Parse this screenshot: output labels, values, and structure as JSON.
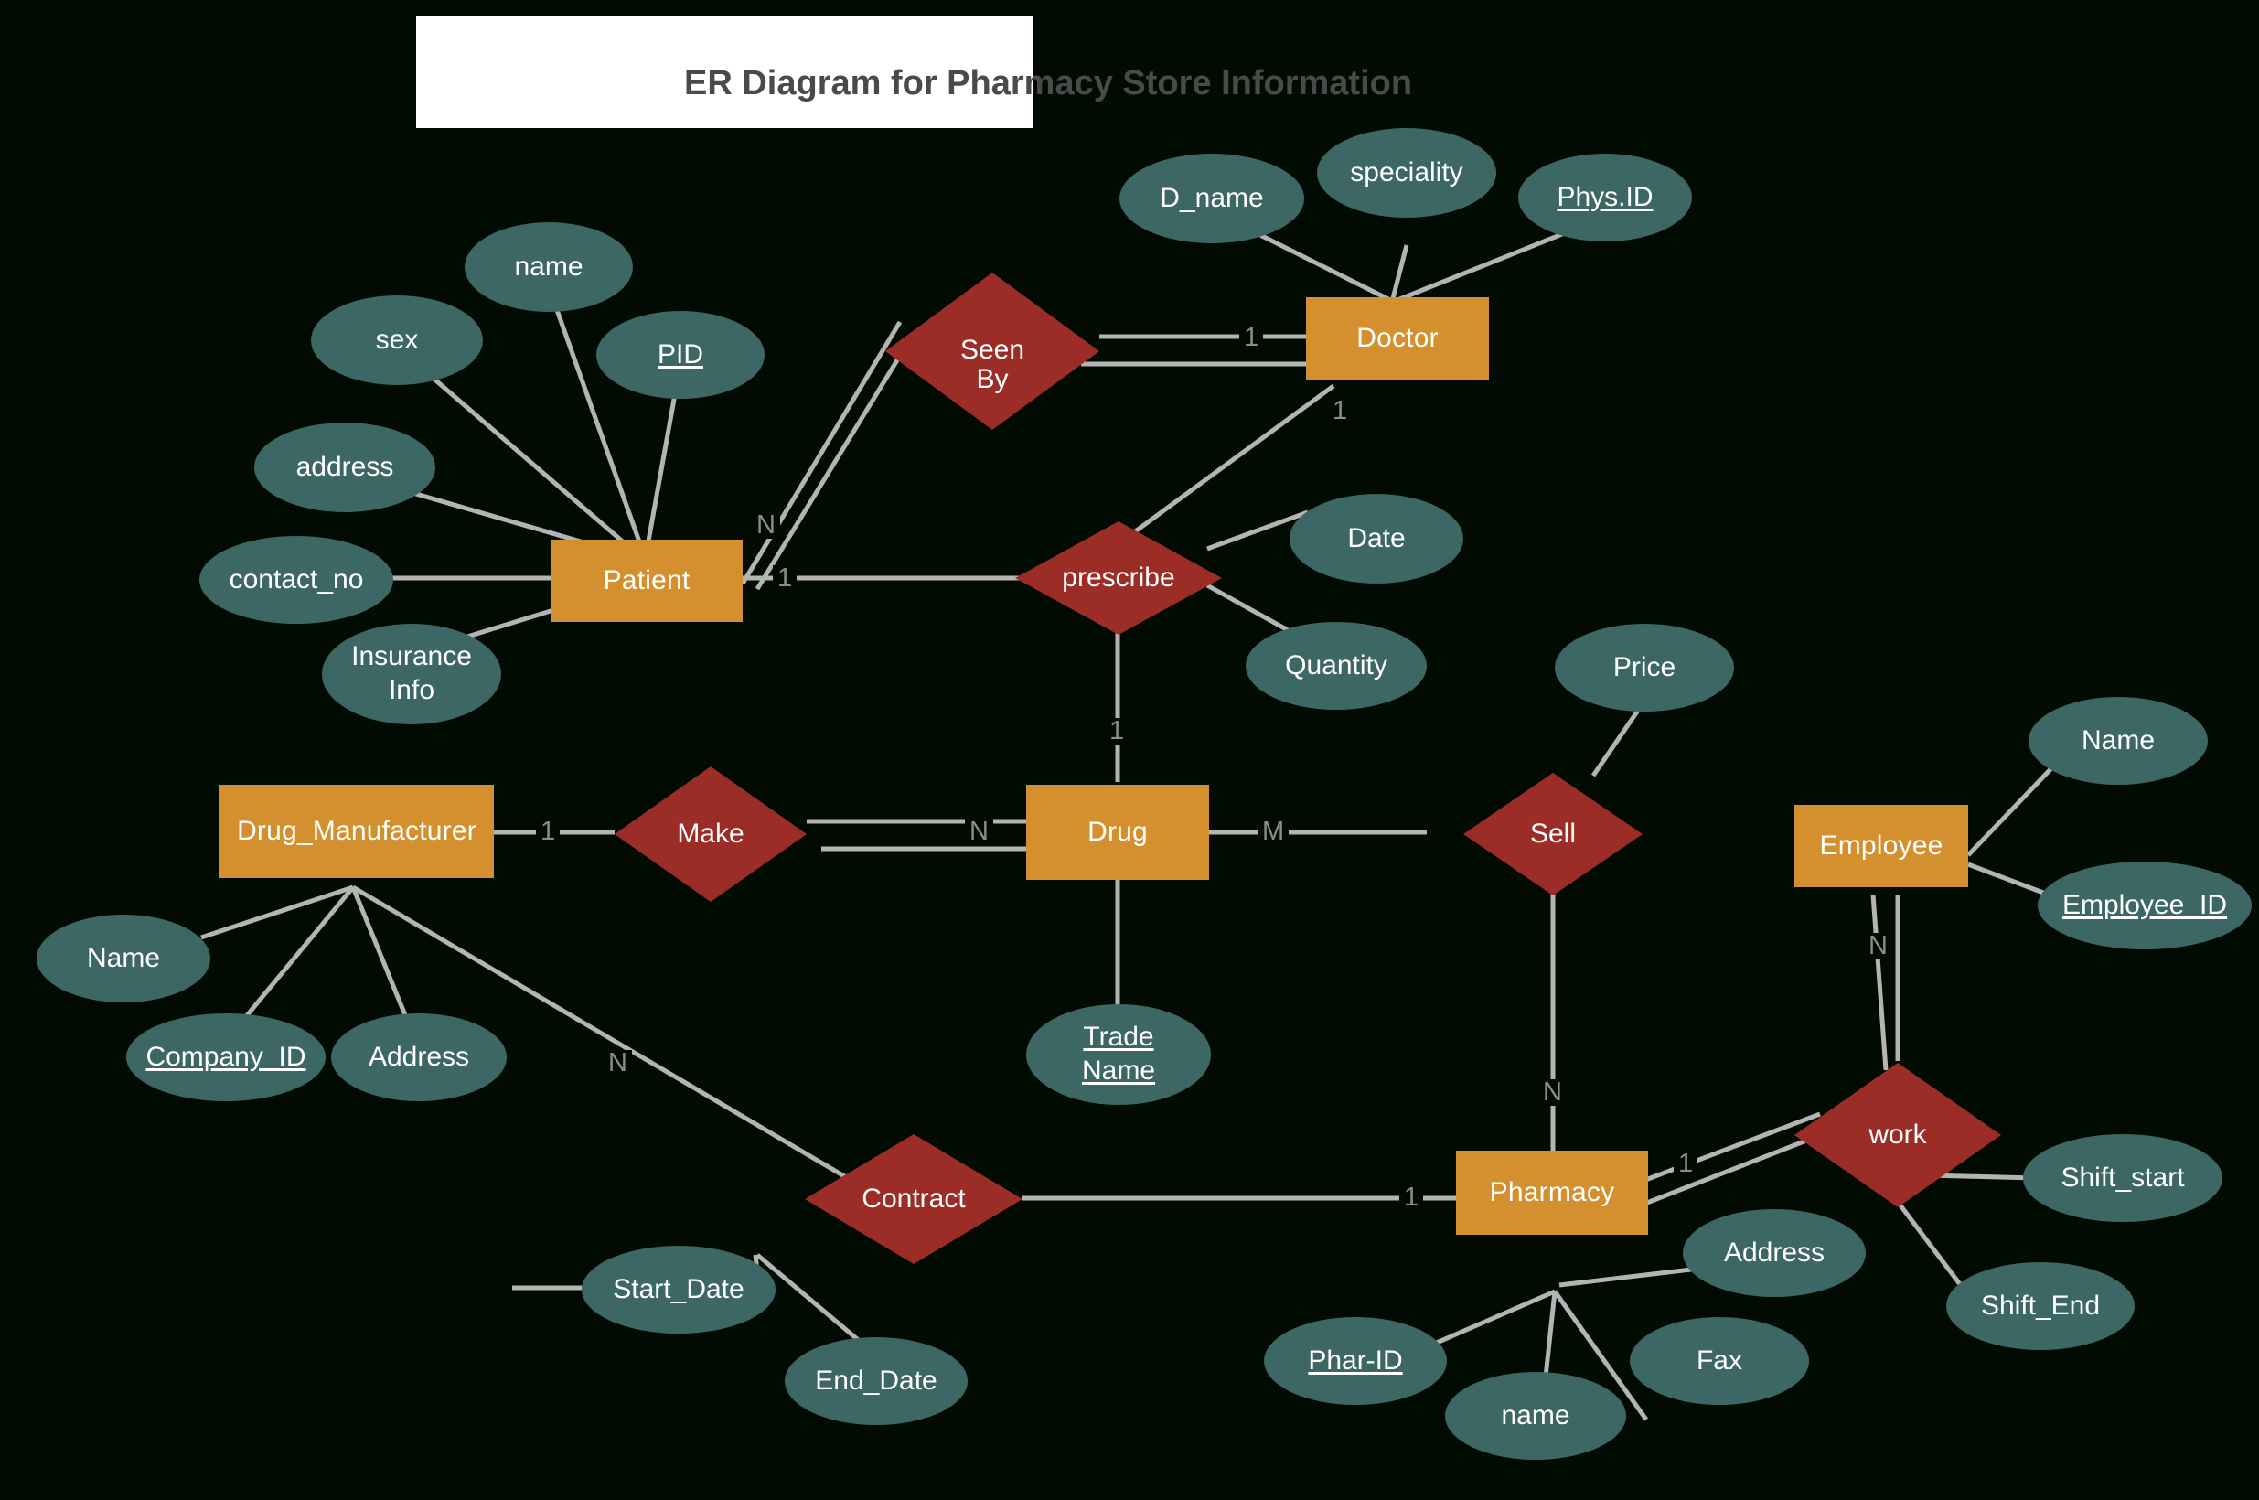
{
  "title": "ER Diagram for Pharmacy Store Information",
  "colors": {
    "background": "#010b02",
    "entity": "#d4902f",
    "relationship": "#9b2d26",
    "attribute": "#3c6764",
    "edge": "#b4b4b4",
    "cardinality_text": "#8c8c8c",
    "title_text": "#4a4a4a",
    "title_card": "#ffffff"
  },
  "entities": [
    {
      "id": "patient",
      "label": "Patient"
    },
    {
      "id": "doctor",
      "label": "Doctor"
    },
    {
      "id": "drugman",
      "label": "Drug_Manufacturer"
    },
    {
      "id": "drug",
      "label": "Drug"
    },
    {
      "id": "pharmacy",
      "label": "Pharmacy"
    },
    {
      "id": "employee",
      "label": "Employee"
    }
  ],
  "relationships": [
    {
      "id": "seenby",
      "label": "Seen By"
    },
    {
      "id": "prescribe",
      "label": "prescribe"
    },
    {
      "id": "make",
      "label": "Make"
    },
    {
      "id": "sell",
      "label": "Sell"
    },
    {
      "id": "contract",
      "label": "Contract"
    },
    {
      "id": "work",
      "label": "work"
    }
  ],
  "attributes": [
    {
      "id": "p_name",
      "label": "name",
      "key": false,
      "owner": "patient"
    },
    {
      "id": "p_sex",
      "label": "sex",
      "key": false,
      "owner": "patient"
    },
    {
      "id": "p_pid",
      "label": "PID",
      "key": true,
      "owner": "patient"
    },
    {
      "id": "p_address",
      "label": "address",
      "key": false,
      "owner": "patient"
    },
    {
      "id": "p_contact",
      "label": "contact_no",
      "key": false,
      "owner": "patient"
    },
    {
      "id": "p_ins",
      "label": "Insurance Info",
      "key": false,
      "owner": "patient"
    },
    {
      "id": "d_dname",
      "label": "D_name",
      "key": false,
      "owner": "doctor"
    },
    {
      "id": "d_spec",
      "label": "speciality",
      "key": false,
      "owner": "doctor"
    },
    {
      "id": "d_physid",
      "label": "Phys.ID",
      "key": true,
      "owner": "doctor"
    },
    {
      "id": "pr_date",
      "label": "Date",
      "key": false,
      "owner": "prescribe"
    },
    {
      "id": "pr_qty",
      "label": "Quantity",
      "key": false,
      "owner": "prescribe"
    },
    {
      "id": "dm_name",
      "label": "Name",
      "key": false,
      "owner": "drugman"
    },
    {
      "id": "dm_compid",
      "label": "Company_ID",
      "key": true,
      "owner": "drugman"
    },
    {
      "id": "dm_address",
      "label": "Address",
      "key": false,
      "owner": "drugman"
    },
    {
      "id": "dr_trade",
      "label": "Trade Name",
      "key": true,
      "owner": "drug"
    },
    {
      "id": "se_price",
      "label": "Price",
      "key": false,
      "owner": "sell"
    },
    {
      "id": "c_start",
      "label": "Start_Date",
      "key": false,
      "owner": "contract"
    },
    {
      "id": "c_end",
      "label": "End_Date",
      "key": false,
      "owner": "contract"
    },
    {
      "id": "ph_pharid",
      "label": "Phar-ID",
      "key": true,
      "owner": "pharmacy"
    },
    {
      "id": "ph_name",
      "label": "name",
      "key": false,
      "owner": "pharmacy"
    },
    {
      "id": "ph_fax",
      "label": "Fax",
      "key": false,
      "owner": "pharmacy"
    },
    {
      "id": "ph_address",
      "label": "Address",
      "key": false,
      "owner": "pharmacy"
    },
    {
      "id": "e_name",
      "label": "Name",
      "key": false,
      "owner": "employee"
    },
    {
      "id": "e_empid",
      "label": "Employee_ID",
      "key": true,
      "owner": "employee"
    },
    {
      "id": "w_shiftstart",
      "label": "Shift_start",
      "key": false,
      "owner": "work"
    },
    {
      "id": "w_shiftend",
      "label": "Shift_End",
      "key": false,
      "owner": "work"
    }
  ],
  "attribute_lines": {
    "p_ins_1": "Insurance",
    "p_ins_2": "Info",
    "dr_trade_1": "Trade",
    "dr_trade_2": "Name",
    "seenby_1": "Seen",
    "seenby_2": "By"
  },
  "cardinalities": [
    {
      "id": "c_patient_seenby",
      "value": "N"
    },
    {
      "id": "c_seenby_doctor",
      "value": "1"
    },
    {
      "id": "c_doctor_prescribe",
      "value": "1"
    },
    {
      "id": "c_patient_prescribe",
      "value": "1"
    },
    {
      "id": "c_prescribe_drug",
      "value": "1"
    },
    {
      "id": "c_drugman_make",
      "value": "1"
    },
    {
      "id": "c_make_drug",
      "value": "N"
    },
    {
      "id": "c_drug_sell",
      "value": "M"
    },
    {
      "id": "c_sell_pharmacy",
      "value": "N"
    },
    {
      "id": "c_drugman_contract",
      "value": "N"
    },
    {
      "id": "c_contract_pharmacy",
      "value": "1"
    },
    {
      "id": "c_pharmacy_work",
      "value": "1"
    },
    {
      "id": "c_employee_work",
      "value": "N"
    }
  ]
}
